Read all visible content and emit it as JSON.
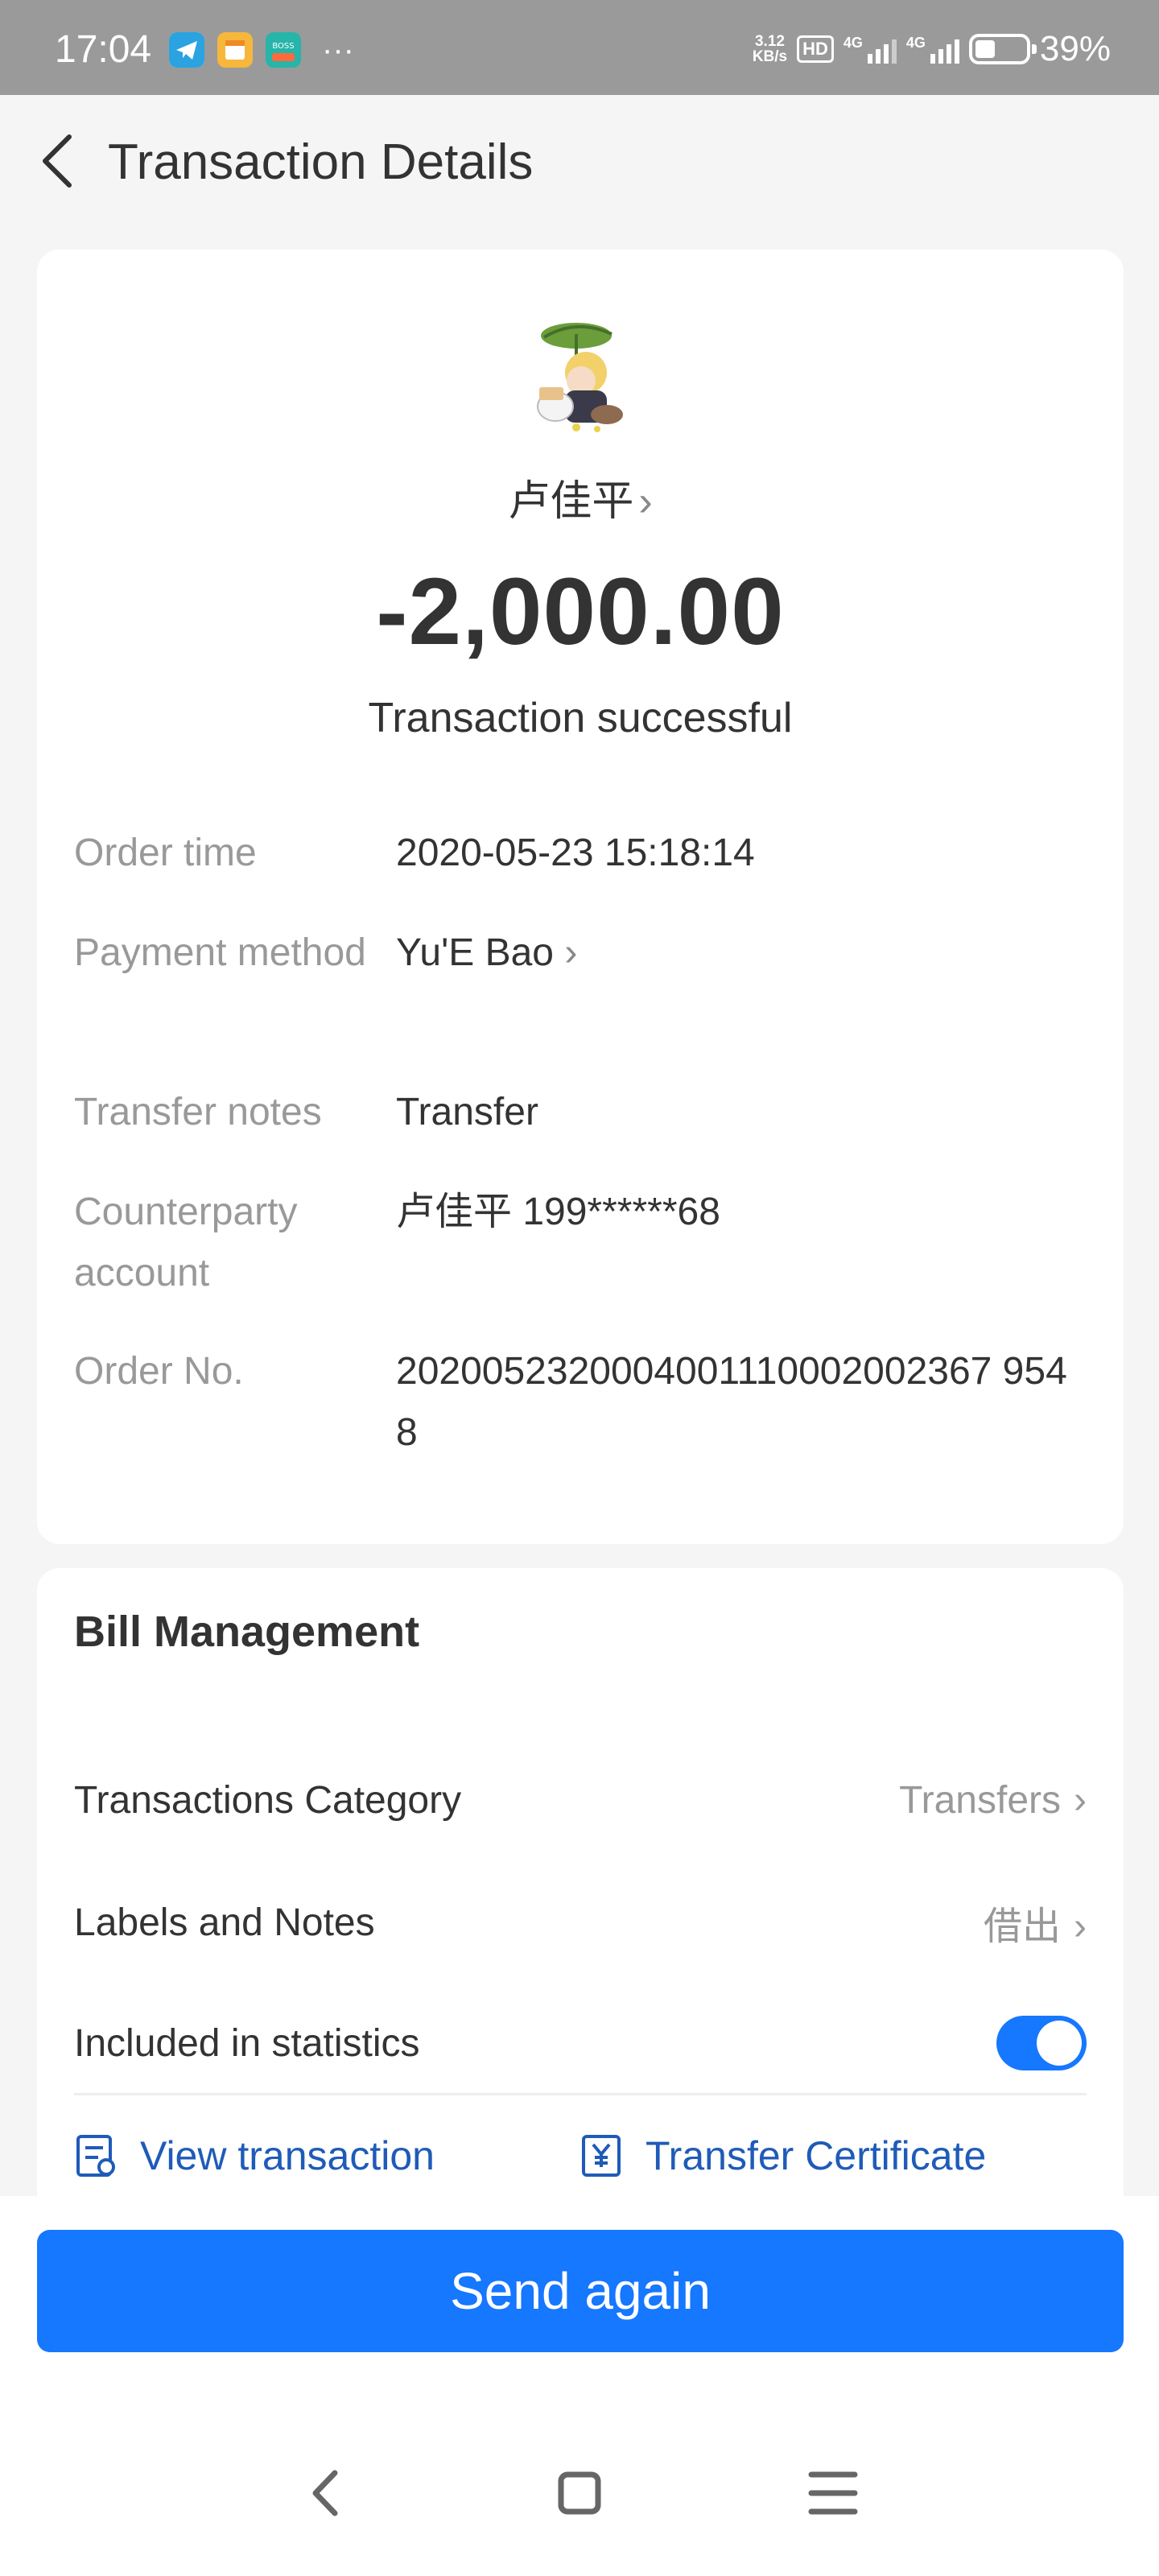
{
  "status_bar": {
    "time": "17:04",
    "net_speed_value": "3.12",
    "net_speed_unit": "KB/s",
    "hd_label": "HD",
    "signal_1": "4G",
    "signal_2": "4G",
    "battery": "39%",
    "overflow": "···"
  },
  "header": {
    "title": "Transaction Details"
  },
  "transaction": {
    "payee": "卢佳平",
    "amount": "-2,000.00",
    "status": "Transaction successful",
    "details": [
      {
        "label": "Order time",
        "value": "2020-05-23 15:18:14"
      },
      {
        "label": "Payment method",
        "value": "Yu'E Bao"
      },
      {
        "label": "Transfer notes",
        "value": "Transfer"
      },
      {
        "label": "Counterparty account",
        "value": "卢佳平 199******68"
      },
      {
        "label": "Order No.",
        "value": "2020052320004001110002002367 9548"
      }
    ]
  },
  "bill_management": {
    "title": "Bill Management",
    "category_label": "Transactions Category",
    "category_value": "Transfers",
    "notes_label": "Labels and Notes",
    "notes_value": "借出",
    "stats_label": "Included in statistics",
    "stats_enabled": true,
    "view_transaction": "View transaction",
    "transfer_certificate": "Transfer Certificate"
  },
  "actions": {
    "send_again": "Send again"
  },
  "colors": {
    "accent": "#1677ff",
    "link": "#1f5bb8",
    "status_bar": "#9a9a9a"
  }
}
